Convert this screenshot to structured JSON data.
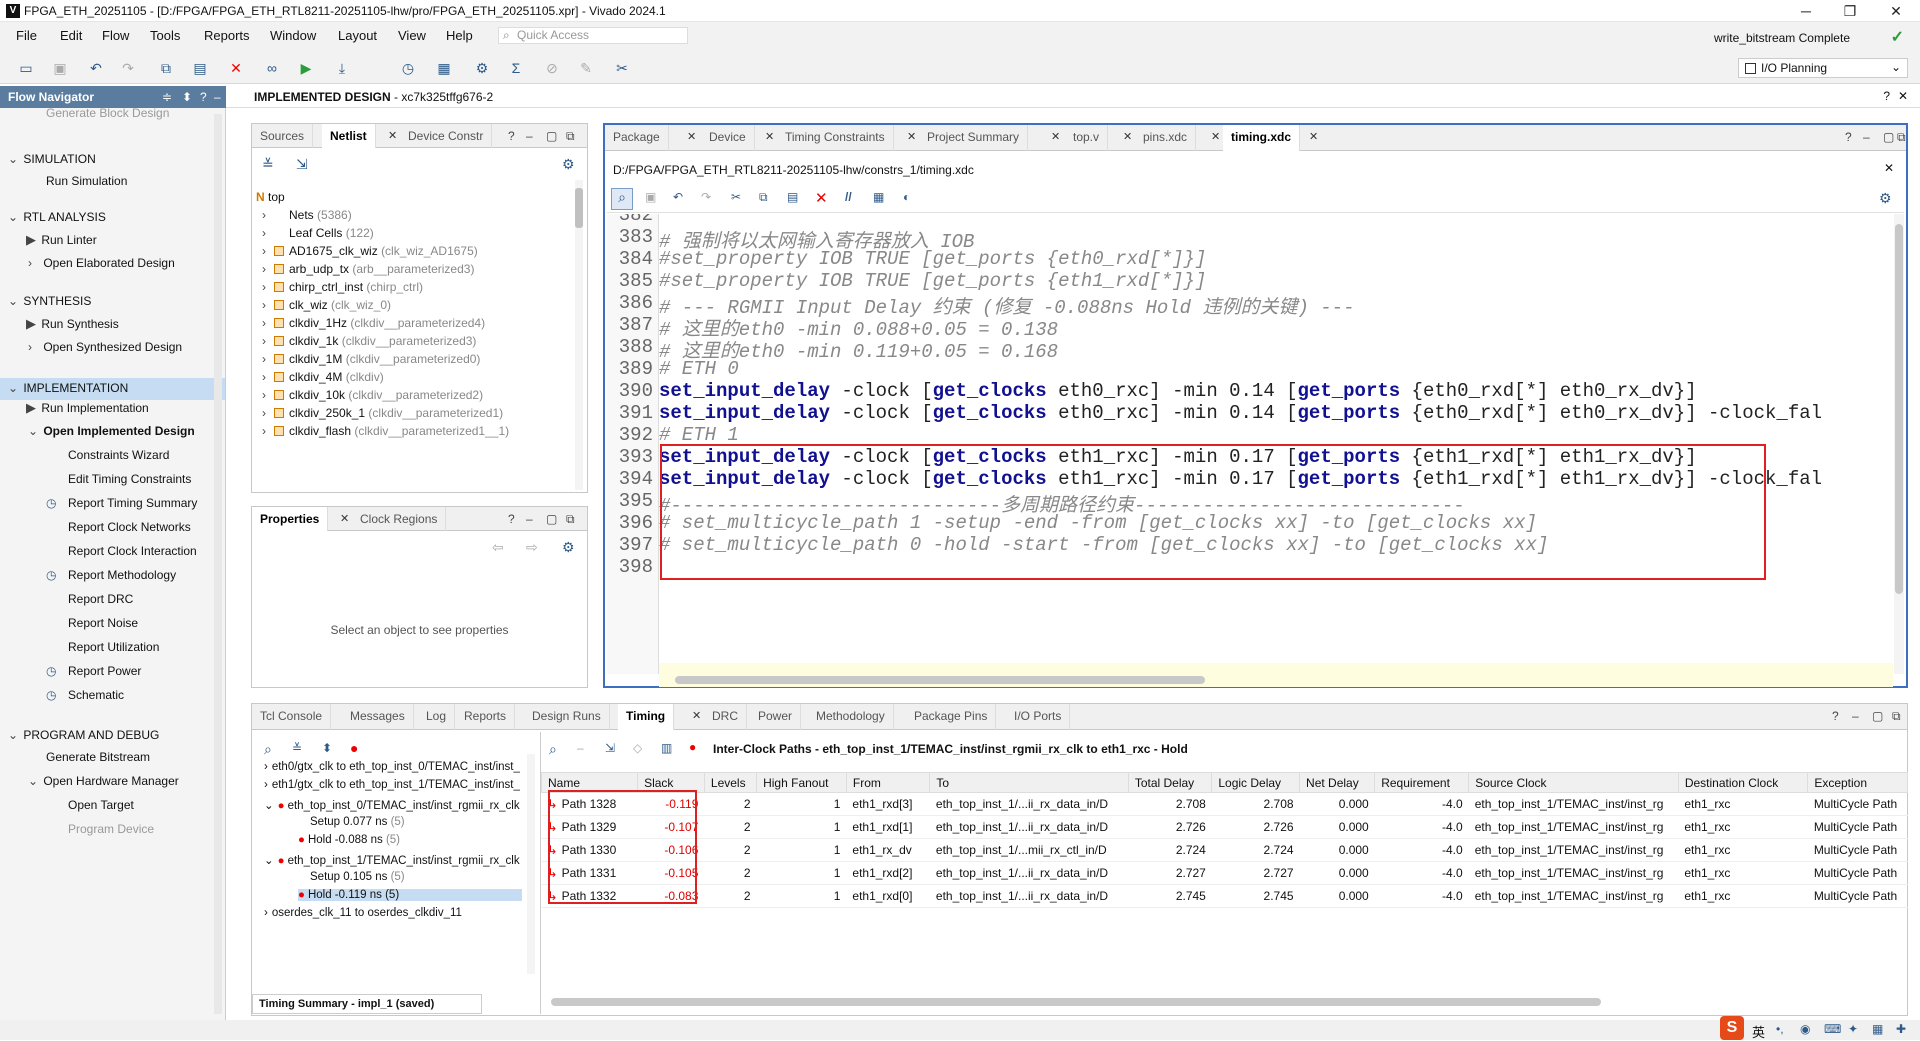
{
  "window": {
    "title": "FPGA_ETH_20251105 - [D:/FPGA/FPGA_ETH_RTL8211-20251105-lhw/pro/FPGA_ETH_20251105.xpr] - Vivado 2024.1",
    "min": "─",
    "max": "❐",
    "close": "✕"
  },
  "menu": [
    "File",
    "Edit",
    "Flow",
    "Tools",
    "Reports",
    "Window",
    "Layout",
    "View",
    "Help"
  ],
  "quick_access": "Quick Access",
  "status": "write_bitstream Complete",
  "layout_select": "I/O Planning",
  "flow_nav": {
    "title": "Flow Navigator",
    "items": [
      {
        "label": "Generate Block Design",
        "type": "item",
        "faded": true
      },
      {
        "label": "SIMULATION",
        "type": "section"
      },
      {
        "label": "Run Simulation",
        "type": "item"
      },
      {
        "label": "RTL ANALYSIS",
        "type": "section"
      },
      {
        "label": "Run Linter",
        "type": "run"
      },
      {
        "label": "Open Elaborated Design",
        "type": "sub"
      },
      {
        "label": "SYNTHESIS",
        "type": "section"
      },
      {
        "label": "Run Synthesis",
        "type": "run"
      },
      {
        "label": "Open Synthesized Design",
        "type": "sub"
      },
      {
        "label": "IMPLEMENTATION",
        "type": "section",
        "highlight": true
      },
      {
        "label": "Run Implementation",
        "type": "run"
      },
      {
        "label": "Open Implemented Design",
        "type": "subopen"
      },
      {
        "label": "Constraints Wizard",
        "type": "leaf"
      },
      {
        "label": "Edit Timing Constraints",
        "type": "leaf"
      },
      {
        "label": "Report Timing Summary",
        "type": "leaf"
      },
      {
        "label": "Report Clock Networks",
        "type": "leaf"
      },
      {
        "label": "Report Clock Interaction",
        "type": "leaf"
      },
      {
        "label": "Report Methodology",
        "type": "leaf"
      },
      {
        "label": "Report DRC",
        "type": "leaf"
      },
      {
        "label": "Report Noise",
        "type": "leaf"
      },
      {
        "label": "Report Utilization",
        "type": "leaf"
      },
      {
        "label": "Report Power",
        "type": "leaf"
      },
      {
        "label": "Schematic",
        "type": "leaf"
      },
      {
        "label": "PROGRAM AND DEBUG",
        "type": "section"
      },
      {
        "label": "Generate Bitstream",
        "type": "item"
      },
      {
        "label": "Open Hardware Manager",
        "type": "subopen"
      },
      {
        "label": "Open Target",
        "type": "leaf"
      },
      {
        "label": "Program Device",
        "type": "leaf",
        "faded": true
      }
    ]
  },
  "impl_header": {
    "title": "IMPLEMENTED DESIGN",
    "device": " - xc7k325tffg676-2"
  },
  "netlist": {
    "tabs": [
      "Sources",
      "Netlist",
      "Device Constr"
    ],
    "root": "top",
    "rows": [
      {
        "name": "Nets",
        "extra": "(5386)",
        "mod": false
      },
      {
        "name": "Leaf Cells",
        "extra": "(122)",
        "mod": false
      },
      {
        "name": "AD1675_clk_wiz",
        "extra": "(clk_wiz_AD1675)",
        "mod": true
      },
      {
        "name": "arb_udp_tx",
        "extra": "(arb__parameterized3)",
        "mod": true
      },
      {
        "name": "chirp_ctrl_inst",
        "extra": "(chirp_ctrl)",
        "mod": true
      },
      {
        "name": "clk_wiz",
        "extra": "(clk_wiz_0)",
        "mod": true
      },
      {
        "name": "clkdiv_1Hz",
        "extra": "(clkdiv__parameterized4)",
        "mod": true
      },
      {
        "name": "clkdiv_1k",
        "extra": "(clkdiv__parameterized3)",
        "mod": true
      },
      {
        "name": "clkdiv_1M",
        "extra": "(clkdiv__parameterized0)",
        "mod": true
      },
      {
        "name": "clkdiv_4M",
        "extra": "(clkdiv)",
        "mod": true
      },
      {
        "name": "clkdiv_10k",
        "extra": "(clkdiv__parameterized2)",
        "mod": true
      },
      {
        "name": "clkdiv_250k_1",
        "extra": "(clkdiv__parameterized1)",
        "mod": true
      },
      {
        "name": "clkdiv_flash",
        "extra": "(clkdiv__parameterized1__1)",
        "mod": true
      }
    ]
  },
  "properties": {
    "tabs": [
      "Properties",
      "Clock Regions"
    ],
    "empty": "Select an object to see properties"
  },
  "editor": {
    "tabs": [
      "Package",
      "Device",
      "Timing Constraints",
      "Project Summary",
      "top.v",
      "pins.xdc",
      "timing.xdc"
    ],
    "path": "D:/FPGA/FPGA_ETH_RTL8211-20251105-lhw/constrs_1/timing.xdc",
    "lines": [
      {
        "n": "382",
        "segs": []
      },
      {
        "n": "383",
        "segs": [
          {
            "t": "# 强制将以太网输入寄存器放入 IOB",
            "c": "cmt"
          }
        ]
      },
      {
        "n": "384",
        "segs": [
          {
            "t": "#set_property IOB TRUE [get_ports {eth0_rxd[*]}]",
            "c": "cmt"
          }
        ]
      },
      {
        "n": "385",
        "segs": [
          {
            "t": "#set_property IOB TRUE [get_ports {eth1_rxd[*]}]",
            "c": "cmt"
          }
        ]
      },
      {
        "n": "386",
        "segs": [
          {
            "t": "# --- RGMII Input Delay 约束 (修复 -0.088ns Hold 违例的关键) ---",
            "c": "cmt"
          }
        ]
      },
      {
        "n": "387",
        "segs": [
          {
            "t": "# 这里的eth0 -min 0.088+0.05 = 0.138",
            "c": "cmt"
          }
        ]
      },
      {
        "n": "388",
        "segs": [
          {
            "t": "# 这里的eth0 -min 0.119+0.05 = 0.168",
            "c": "cmt"
          }
        ]
      },
      {
        "n": "389",
        "segs": [
          {
            "t": "# ETH 0",
            "c": "cmt"
          }
        ]
      },
      {
        "n": "390",
        "segs": [
          {
            "t": "set_input_delay",
            "c": "kw"
          },
          {
            "t": " -clock [",
            "c": ""
          },
          {
            "t": "get_clocks",
            "c": "kw"
          },
          {
            "t": " eth0_rxc] -min 0.14 [",
            "c": ""
          },
          {
            "t": "get_ports",
            "c": "kw"
          },
          {
            "t": " {eth0_rxd[*] eth0_rx_dv}]",
            "c": ""
          }
        ]
      },
      {
        "n": "391",
        "segs": [
          {
            "t": "set_input_delay",
            "c": "kw"
          },
          {
            "t": " -clock [",
            "c": ""
          },
          {
            "t": "get_clocks",
            "c": "kw"
          },
          {
            "t": " eth0_rxc] -min 0.14 [",
            "c": ""
          },
          {
            "t": "get_ports",
            "c": "kw"
          },
          {
            "t": " {eth0_rxd[*] eth0_rx_dv}] -clock_fal",
            "c": ""
          }
        ]
      },
      {
        "n": "392",
        "segs": [
          {
            "t": "# ETH 1",
            "c": "cmt"
          }
        ]
      },
      {
        "n": "393",
        "segs": [
          {
            "t": "set_input_delay",
            "c": "kw"
          },
          {
            "t": " -clock [",
            "c": ""
          },
          {
            "t": "get_clocks",
            "c": "kw"
          },
          {
            "t": " eth1_rxc] -min 0.17 [",
            "c": ""
          },
          {
            "t": "get_ports",
            "c": "kw"
          },
          {
            "t": " {eth1_rxd[*] eth1_rx_dv}]",
            "c": ""
          }
        ]
      },
      {
        "n": "394",
        "segs": [
          {
            "t": "set_input_delay",
            "c": "kw"
          },
          {
            "t": " -clock [",
            "c": ""
          },
          {
            "t": "get_clocks",
            "c": "kw"
          },
          {
            "t": " eth1_rxc] -min 0.17 [",
            "c": ""
          },
          {
            "t": "get_ports",
            "c": "kw"
          },
          {
            "t": " {eth1_rxd[*] eth1_rx_dv}] -clock_fal",
            "c": ""
          }
        ]
      },
      {
        "n": "395",
        "segs": [
          {
            "t": "#-----------------------------多周期路径约束-----------------------------",
            "c": "cmt"
          }
        ]
      },
      {
        "n": "396",
        "segs": [
          {
            "t": "# set_multicycle_path 1 -setup -end -from [get_clocks xx] -to [get_clocks xx]",
            "c": "cmt"
          }
        ]
      },
      {
        "n": "397",
        "segs": [
          {
            "t": "# set_multicycle_path 0 -hold -start -from [get_clocks xx] -to [get_clocks xx]",
            "c": "cmt"
          }
        ]
      },
      {
        "n": "398",
        "segs": []
      }
    ]
  },
  "bottom": {
    "tabs": [
      "Tcl Console",
      "Messages",
      "Log",
      "Reports",
      "Design Runs",
      "Timing",
      "DRC",
      "Power",
      "Methodology",
      "Package Pins",
      "I/O Ports"
    ],
    "header": "Inter-Clock Paths - eth_top_inst_1/TEMAC_inst/inst_rgmii_rx_clk to eth1_rxc - Hold",
    "tree": [
      {
        "label": "eth0/gtx_clk to eth_top_inst_0/TEMAC_inst/inst_",
        "lvl": 0,
        "err": false,
        "exp": false
      },
      {
        "label": "eth1/gtx_clk to eth_top_inst_1/TEMAC_inst/inst_",
        "lvl": 0,
        "err": false,
        "exp": false
      },
      {
        "label": "eth_top_inst_0/TEMAC_inst/inst_rgmii_rx_clk to",
        "lvl": 0,
        "err": true,
        "exp": true
      },
      {
        "label": "Setup 0.077 ns",
        "extra": "(5)",
        "lvl": 1,
        "err": false
      },
      {
        "label": "Hold -0.088 ns",
        "extra": "(5)",
        "lvl": 1,
        "err": true
      },
      {
        "label": "eth_top_inst_1/TEMAC_inst/inst_rgmii_rx_clk to",
        "lvl": 0,
        "err": true,
        "exp": true
      },
      {
        "label": "Setup 0.105 ns",
        "extra": "(5)",
        "lvl": 1,
        "err": false
      },
      {
        "label": "Hold -0.119 ns (5)",
        "extra": "",
        "lvl": 1,
        "err": true,
        "sel": true
      },
      {
        "label": "oserdes_clk_11 to oserdes_clkdiv_11",
        "lvl": 0,
        "err": false,
        "exp": false
      }
    ],
    "summary": "Timing Summary - impl_1 (saved)",
    "columns": [
      "Name",
      "Slack",
      "Levels",
      "High Fanout",
      "From",
      "To",
      "Total Delay",
      "Logic Delay",
      "Net Delay",
      "Requirement",
      "Source Clock",
      "Destination Clock",
      "Exception"
    ],
    "rows": [
      [
        "Path 1328",
        "-0.119",
        "2",
        "1",
        "eth1_rxd[3]",
        "eth_top_inst_1/...ii_rx_data_in/D",
        "2.708",
        "2.708",
        "0.000",
        "-4.0",
        "eth_top_inst_1/TEMAC_inst/inst_rg",
        "eth1_rxc",
        "MultiCycle Path"
      ],
      [
        "Path 1329",
        "-0.107",
        "2",
        "1",
        "eth1_rxd[1]",
        "eth_top_inst_1/...ii_rx_data_in/D",
        "2.726",
        "2.726",
        "0.000",
        "-4.0",
        "eth_top_inst_1/TEMAC_inst/inst_rg",
        "eth1_rxc",
        "MultiCycle Path"
      ],
      [
        "Path 1330",
        "-0.106",
        "2",
        "1",
        "eth1_rx_dv",
        "eth_top_inst_1/...mii_rx_ctl_in/D",
        "2.724",
        "2.724",
        "0.000",
        "-4.0",
        "eth_top_inst_1/TEMAC_inst/inst_rg",
        "eth1_rxc",
        "MultiCycle Path"
      ],
      [
        "Path 1331",
        "-0.105",
        "2",
        "1",
        "eth1_rxd[2]",
        "eth_top_inst_1/...ii_rx_data_in/D",
        "2.727",
        "2.727",
        "0.000",
        "-4.0",
        "eth_top_inst_1/TEMAC_inst/inst_rg",
        "eth1_rxc",
        "MultiCycle Path"
      ],
      [
        "Path 1332",
        "-0.083",
        "2",
        "1",
        "eth1_rxd[0]",
        "eth_top_inst_1/...ii_rx_data_in/D",
        "2.745",
        "2.745",
        "0.000",
        "-4.0",
        "eth_top_inst_1/TEMAC_inst/inst_rg",
        "eth1_rxc",
        "MultiCycle Path"
      ]
    ]
  },
  "tray": {
    "ime": "英"
  }
}
